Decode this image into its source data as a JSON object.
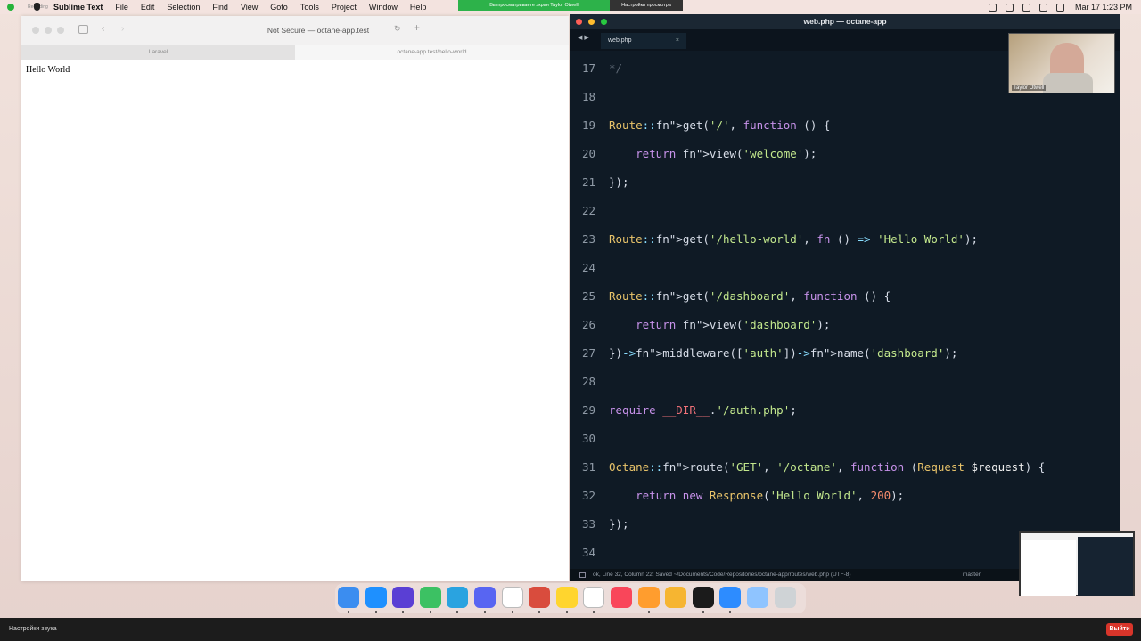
{
  "menubar": {
    "rec_label": "Recording",
    "app_name": "Sublime Text",
    "menus": [
      "File",
      "Edit",
      "Selection",
      "Find",
      "View",
      "Goto",
      "Tools",
      "Project",
      "Window",
      "Help"
    ],
    "share_text": "Вы просматриваете экран Taylor Otwell",
    "share_settings": "Настройки просмотра",
    "clock": "Mar 17  1:23 PM"
  },
  "browser": {
    "url": "Not Secure — octane-app.test",
    "tabs": [
      "Laravel",
      "octane-app.test/hello-world"
    ],
    "page_text": "Hello World"
  },
  "editor": {
    "window_title": "web.php — octane-app",
    "tab_label": "web.php",
    "status_left": "ok, Line 32, Column 22; Saved ~/Documents/Code/Repositories/octane-app/routes/web.php (UTF-8)",
    "status_branch": "master",
    "lines": [
      {
        "n": "17",
        "t": "*/"
      },
      {
        "n": "18",
        "t": ""
      },
      {
        "n": "19",
        "t": "Route::get('/', function () {"
      },
      {
        "n": "20",
        "t": "    return view('welcome');"
      },
      {
        "n": "21",
        "t": "});"
      },
      {
        "n": "22",
        "t": ""
      },
      {
        "n": "23",
        "t": "Route::get('/hello-world', fn () => 'Hello World');"
      },
      {
        "n": "24",
        "t": ""
      },
      {
        "n": "25",
        "t": "Route::get('/dashboard', function () {"
      },
      {
        "n": "26",
        "t": "    return view('dashboard');"
      },
      {
        "n": "27",
        "t": "})->middleware(['auth'])->name('dashboard');"
      },
      {
        "n": "28",
        "t": ""
      },
      {
        "n": "29",
        "t": "require __DIR__.'/auth.php';"
      },
      {
        "n": "30",
        "t": ""
      },
      {
        "n": "31",
        "t": "Octane::route('GET', '/octane', function (Request $request) {"
      },
      {
        "n": "32",
        "t": "    return new Response('Hello World', 200);"
      },
      {
        "n": "33",
        "t": "});"
      },
      {
        "n": "34",
        "t": ""
      }
    ]
  },
  "webcam": {
    "name": "Taylor Otwell"
  },
  "dock": {
    "icons": [
      "finder-icon",
      "safari-icon",
      "hand-icon",
      "messages-icon",
      "telegram-icon",
      "discord-icon",
      "notion-icon",
      "todoist-icon",
      "mango-icon",
      "slack-icon",
      "music-icon",
      "sublime-icon",
      "sketch-icon",
      "terminal-icon",
      "zoom-icon",
      "folder-icon",
      "trash-icon"
    ],
    "colors": [
      "#3b8df0",
      "#1e90ff",
      "#5a3fd4",
      "#3cc163",
      "#2aa3e0",
      "#5865f2",
      "#ffffff",
      "#d94c3d",
      "#ffd52e",
      "#ffffff",
      "#f9465a",
      "#ff9d2e",
      "#f6b531",
      "#1b1b1b",
      "#2d8cff",
      "#8fc4ff",
      "#cfd3d6"
    ]
  },
  "bottombar": {
    "sound_settings": "Настройки звука",
    "exit": "Выйти"
  }
}
